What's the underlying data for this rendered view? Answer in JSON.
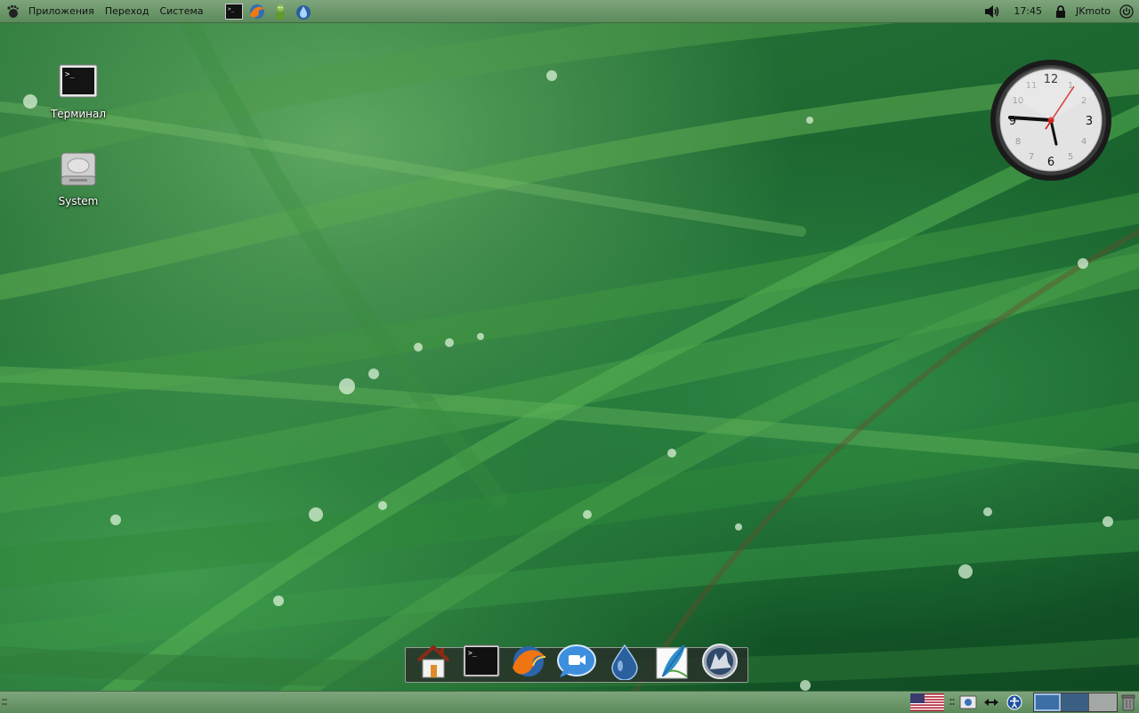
{
  "top_panel": {
    "menus": [
      "Приложения",
      "Переход",
      "Система"
    ],
    "launchers": [
      "terminal-launcher-icon",
      "firefox-launcher-icon",
      "pidgin-launcher-icon",
      "water-drop-launcher-icon"
    ],
    "time": "17:45",
    "user": "JKmoto"
  },
  "desktop": {
    "icons": [
      {
        "label": "Терминал",
        "icon": "terminal-icon"
      },
      {
        "label": "System",
        "icon": "hard-drive-icon"
      }
    ]
  },
  "clock_widget": {
    "numbers": [
      "12",
      "3",
      "6",
      "9"
    ],
    "minor_numbers": [
      "1",
      "2",
      "4",
      "5",
      "7",
      "8",
      "10",
      "11"
    ],
    "time": "17:45"
  },
  "dock": {
    "items": [
      "home-icon",
      "terminal-icon",
      "firefox-icon",
      "chat-icon",
      "water-drop-icon",
      "feather-icon",
      "wolf-icon"
    ]
  },
  "bottom_panel": {
    "keyboard_layout": "us-flag-icon",
    "workspaces": 3,
    "active_workspace": 1
  },
  "colors": {
    "panel": "#6f996e",
    "wallpaper": "#1f6a33",
    "clock_second_hand": "#d0201a"
  }
}
